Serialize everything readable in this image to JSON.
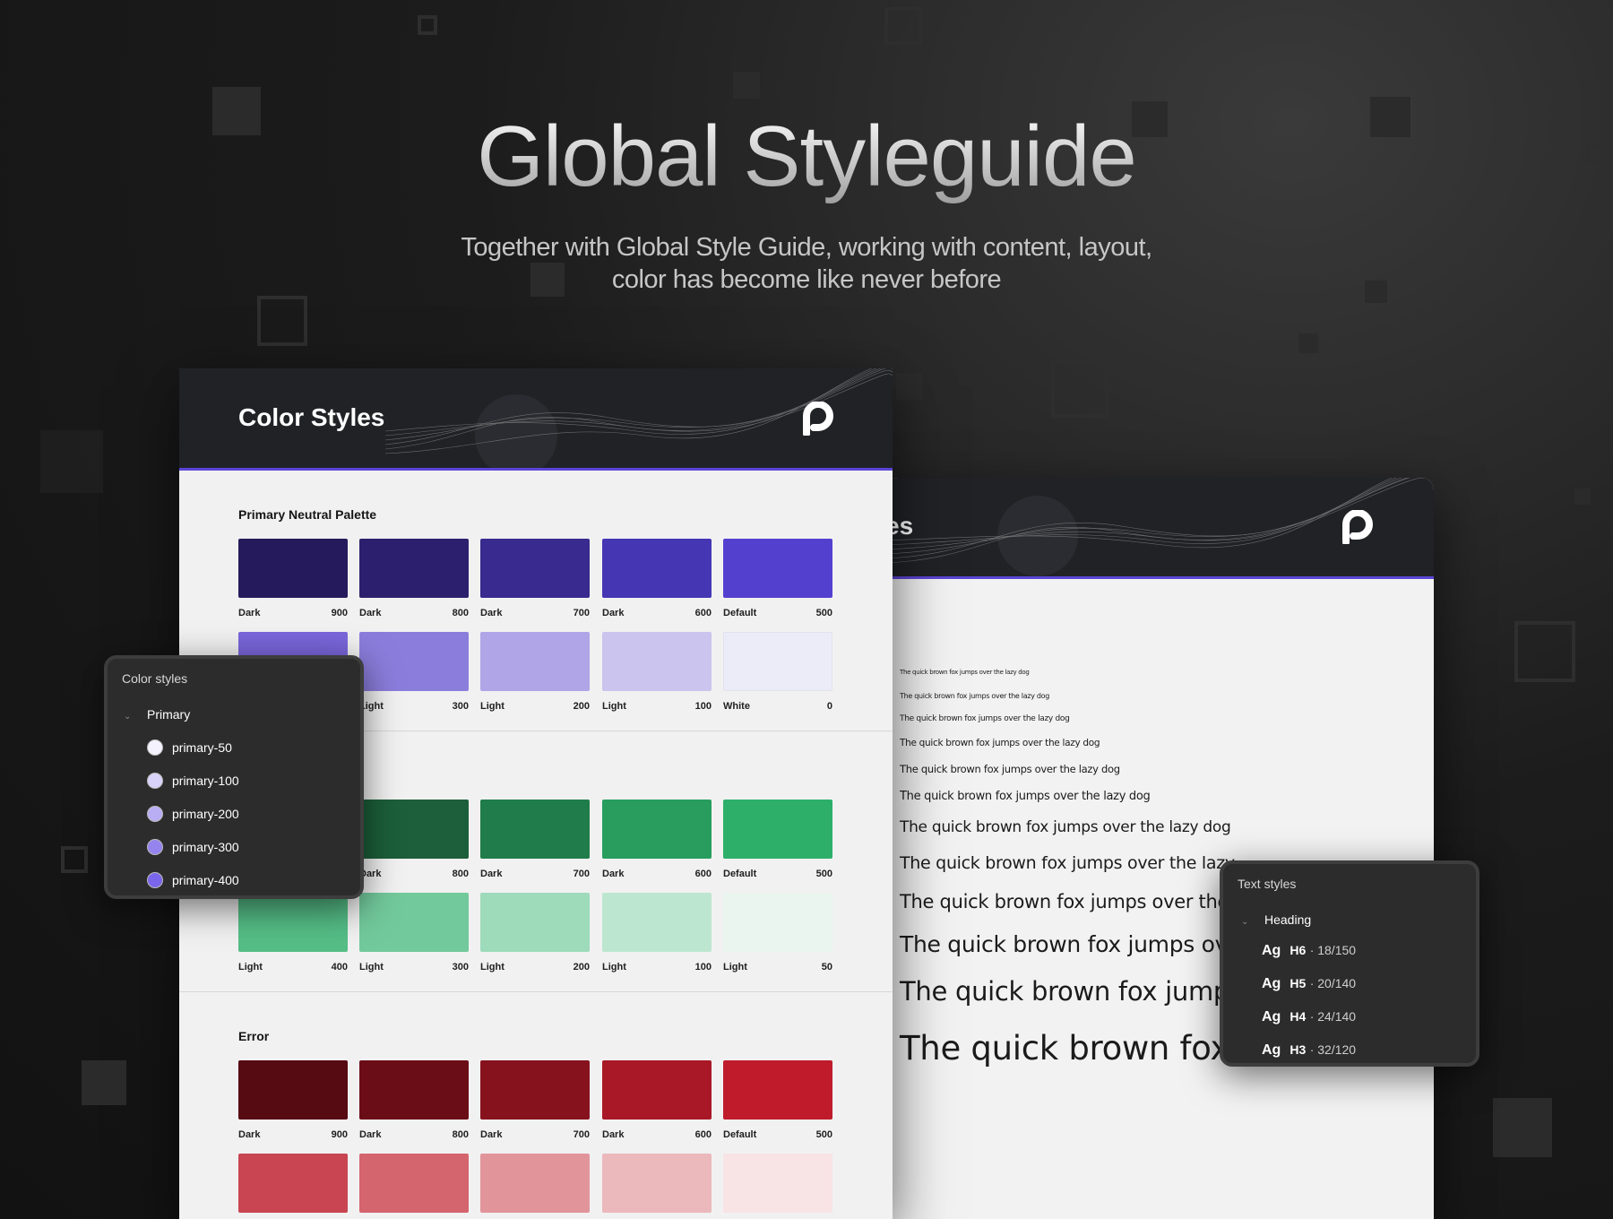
{
  "hero": {
    "title": "Global Styleguide",
    "subtitle_line1": "Together with Global Style Guide, working with content, layout,",
    "subtitle_line2": "color has become like never before"
  },
  "color_card": {
    "title": "Color Styles",
    "sections": [
      {
        "name": "Primary Neutral Palette",
        "rows": [
          [
            {
              "label": "Dark",
              "value": "900",
              "color": "#251b5c"
            },
            {
              "label": "Dark",
              "value": "800",
              "color": "#2c206e"
            },
            {
              "label": "Dark",
              "value": "700",
              "color": "#382a8e"
            },
            {
              "label": "Dark",
              "value": "600",
              "color": "#4536b4"
            },
            {
              "label": "Default",
              "value": "500",
              "color": "#5340cf"
            }
          ],
          [
            {
              "label": "",
              "value": "",
              "color": "#7a66db"
            },
            {
              "label": "Light",
              "value": "300",
              "color": "#8b7ddc"
            },
            {
              "label": "Light",
              "value": "200",
              "color": "#afa5e7"
            },
            {
              "label": "Light",
              "value": "100",
              "color": "#cac4ee"
            },
            {
              "label": "White",
              "value": "0",
              "color": "#ecebf8"
            }
          ]
        ]
      },
      {
        "name": "",
        "rows": [
          [
            {
              "label": "",
              "value": "",
              "color": "#154d31"
            },
            {
              "label": "Dark",
              "value": "800",
              "color": "#1c5f3a"
            },
            {
              "label": "Dark",
              "value": "700",
              "color": "#207c4a"
            },
            {
              "label": "Dark",
              "value": "600",
              "color": "#289d5e"
            },
            {
              "label": "Default",
              "value": "500",
              "color": "#2daf6a"
            }
          ],
          [
            {
              "label": "Light",
              "value": "400",
              "color": "#55be87"
            },
            {
              "label": "Light",
              "value": "300",
              "color": "#72c99b"
            },
            {
              "label": "Light",
              "value": "200",
              "color": "#9ddbba"
            },
            {
              "label": "Light",
              "value": "100",
              "color": "#bde6d0"
            },
            {
              "label": "Light",
              "value": "50",
              "color": "#e9f5ee"
            }
          ]
        ]
      },
      {
        "name": "Error",
        "rows": [
          [
            {
              "label": "Dark",
              "value": "900",
              "color": "#560a12"
            },
            {
              "label": "Dark",
              "value": "800",
              "color": "#6b0d17"
            },
            {
              "label": "Dark",
              "value": "700",
              "color": "#86121e"
            },
            {
              "label": "Dark",
              "value": "600",
              "color": "#a81826"
            },
            {
              "label": "Default",
              "value": "500",
              "color": "#bf1b2b"
            }
          ],
          [
            {
              "label": "",
              "value": "",
              "color": "#c84551"
            },
            {
              "label": "",
              "value": "",
              "color": "#d4646e"
            },
            {
              "label": "",
              "value": "",
              "color": "#e1959b"
            },
            {
              "label": "",
              "value": "",
              "color": "#ebb8bb"
            },
            {
              "label": "",
              "value": "",
              "color": "#f8e3e5"
            }
          ]
        ]
      }
    ]
  },
  "text_card": {
    "title_fragment": "es",
    "samples": [
      "The quick brown fox jumps over the lazy dog",
      "The quick brown fox jumps over the lazy dog",
      "The quick brown fox jumps over the lazy dog",
      "The quick brown fox jumps over the lazy dog",
      "The quick brown fox jumps over the lazy dog",
      "The quick brown fox jumps over the lazy dog",
      "The quick brown fox jumps over the lazy dog",
      "The quick brown fox jumps over the lazy",
      "The quick brown fox jumps over the",
      "The quick brown fox jumps ove",
      "The quick brown fox jumps",
      "The quick brown fox jumps"
    ]
  },
  "color_panel": {
    "title": "Color styles",
    "group": "Primary",
    "items": [
      {
        "name": "primary-50",
        "color": "#f4f2fd"
      },
      {
        "name": "primary-100",
        "color": "#d9d3f9"
      },
      {
        "name": "primary-200",
        "color": "#b9aef4"
      },
      {
        "name": "primary-300",
        "color": "#9584ee"
      },
      {
        "name": "primary-400",
        "color": "#7a66ea"
      }
    ]
  },
  "text_panel": {
    "title": "Text styles",
    "group": "Heading",
    "items": [
      {
        "ag": "Ag",
        "level": "H6",
        "size": "· 18/150"
      },
      {
        "ag": "Ag",
        "level": "H5",
        "size": "· 20/140"
      },
      {
        "ag": "Ag",
        "level": "H4",
        "size": "· 24/140"
      },
      {
        "ag": "Ag",
        "level": "H3",
        "size": "· 32/120"
      }
    ]
  }
}
